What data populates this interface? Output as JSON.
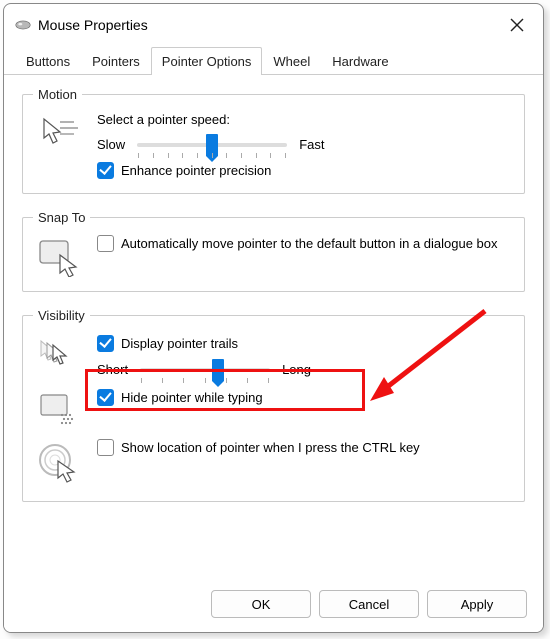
{
  "window": {
    "title": "Mouse Properties"
  },
  "tabs": [
    "Buttons",
    "Pointers",
    "Pointer Options",
    "Wheel",
    "Hardware"
  ],
  "motion": {
    "legend": "Motion",
    "label": "Select a pointer speed:",
    "slow": "Slow",
    "fast": "Fast",
    "enhance": "Enhance pointer precision",
    "speed_value_percent": 50
  },
  "snapto": {
    "legend": "Snap To",
    "auto_move": "Automatically move pointer to the default button in a dialogue box"
  },
  "visibility": {
    "legend": "Visibility",
    "trails": "Display pointer trails",
    "short": "Short",
    "long": "Long",
    "trail_value_percent": 60,
    "hide_typing": "Hide pointer while typing",
    "show_ctrl": "Show location of pointer when I press the CTRL key"
  },
  "buttons": {
    "ok": "OK",
    "cancel": "Cancel",
    "apply": "Apply"
  }
}
